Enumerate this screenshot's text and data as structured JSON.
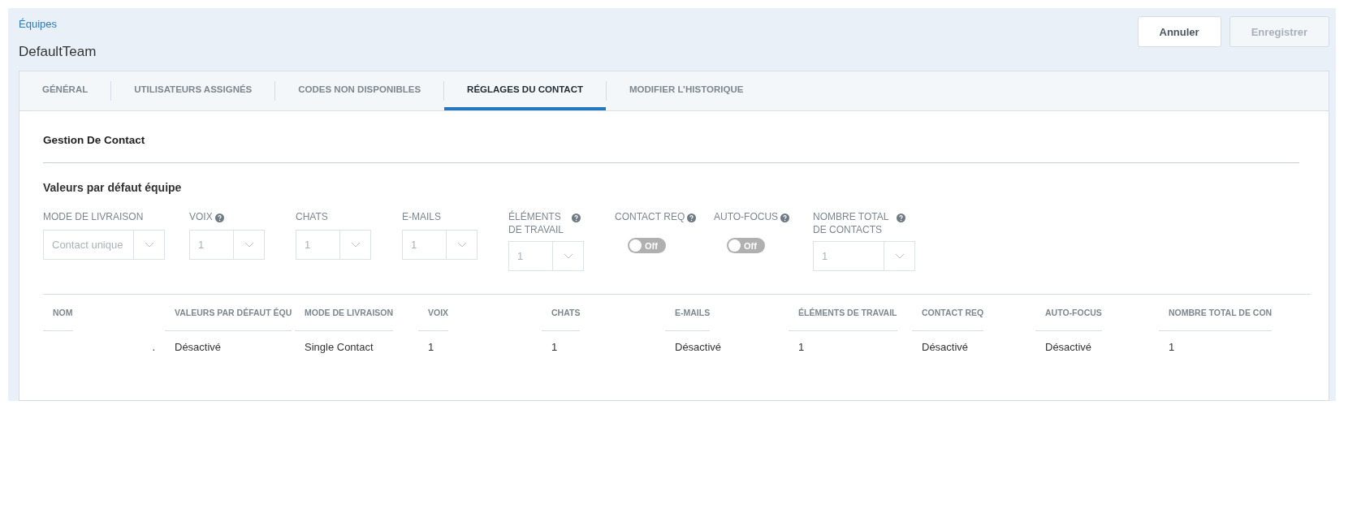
{
  "breadcrumb": "Équipes",
  "title": "DefaultTeam",
  "buttons": [
    {
      "label": "Annuler",
      "disabled": false
    },
    {
      "label": "Enregistrer",
      "disabled": true
    }
  ],
  "tabs": [
    {
      "label": "GÉNÉRAL",
      "selected": false
    },
    {
      "label": "UTILISATEURS ASSIGNÉS",
      "selected": false
    },
    {
      "label": "CODES NON DISPONIBLES",
      "selected": false
    },
    {
      "label": "RÉGLAGES DU CONTACT",
      "selected": true
    },
    {
      "label": "MODIFIER L’HISTORIQUE",
      "selected": false
    }
  ],
  "section_title": "Gestion De Contact",
  "subsection_title": "Valeurs par défaut équipe",
  "fields": [
    {
      "kind": "select",
      "label": "MODE DE LIVRAISON",
      "help": false,
      "value": "Contact unique"
    },
    {
      "kind": "select",
      "label": "VOIX",
      "help": true,
      "value": "1"
    },
    {
      "kind": "select",
      "label": "CHATS",
      "help": false,
      "value": "1"
    },
    {
      "kind": "select",
      "label": "E-MAILS",
      "help": false,
      "value": "1"
    },
    {
      "kind": "select",
      "label": "ÉLÉMENTS DE TRAVAIL",
      "help": true,
      "value": "1"
    },
    {
      "kind": "toggle",
      "label": "CONTACT REQ",
      "help": true,
      "on": false,
      "text": "Off"
    },
    {
      "kind": "toggle",
      "label": "AUTO-FOCUS",
      "help": true,
      "on": false,
      "text": "Off"
    },
    {
      "kind": "select",
      "label": "NOMBRE TOTAL DE CONTACTS",
      "help": true,
      "value": "1"
    }
  ],
  "table": {
    "columns": [
      "NOM",
      "VALEURS PAR DÉFAUT ÉQU",
      "MODE DE LIVRAISON",
      "VOIX",
      "CHATS",
      "E-MAILS",
      "ÉLÉMENTS DE TRAVAIL",
      "CONTACT REQ",
      "AUTO-FOCUS",
      "NOMBRE TOTAL DE CON"
    ],
    "rows": [
      [
        ".",
        "Désactivé",
        "Single Contact",
        "1",
        "1",
        "Désactivé",
        "1",
        "Désactivé",
        "Désactivé",
        "1"
      ]
    ]
  }
}
